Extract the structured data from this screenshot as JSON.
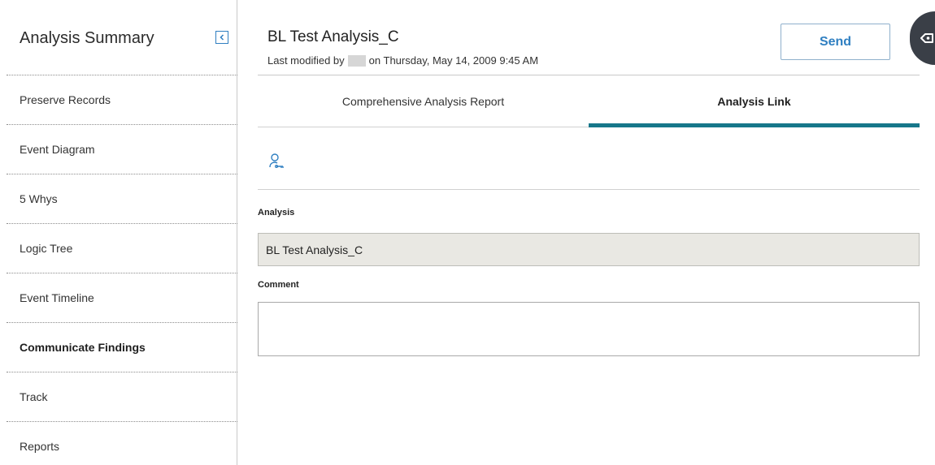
{
  "sidebar": {
    "title": "Analysis Summary",
    "items": [
      {
        "label": "Preserve Records"
      },
      {
        "label": "Event Diagram"
      },
      {
        "label": "5 Whys"
      },
      {
        "label": "Logic Tree"
      },
      {
        "label": "Event Timeline"
      },
      {
        "label": "Communicate Findings",
        "active": true
      },
      {
        "label": "Track"
      },
      {
        "label": "Reports"
      }
    ]
  },
  "header": {
    "title": "BL Test Analysis_C",
    "modified_prefix": "Last modified by",
    "modified_suffix": "on Thursday, May 14, 2009 9:45 AM",
    "send_label": "Send"
  },
  "tabs": [
    {
      "label": "Comprehensive Analysis Report",
      "active": false
    },
    {
      "label": "Analysis Link",
      "active": true
    }
  ],
  "form": {
    "analysis_label": "Analysis",
    "analysis_value": "BL Test Analysis_C",
    "comment_label": "Comment",
    "comment_value": ""
  },
  "icons": {
    "collapse": "collapse-sidebar-icon",
    "link": "user-key-icon",
    "side_panel": "side-panel-toggle-icon"
  },
  "colors": {
    "accent": "#17778a",
    "link_blue": "#2f7fc1",
    "readonly_field": "#e9e8e3"
  }
}
